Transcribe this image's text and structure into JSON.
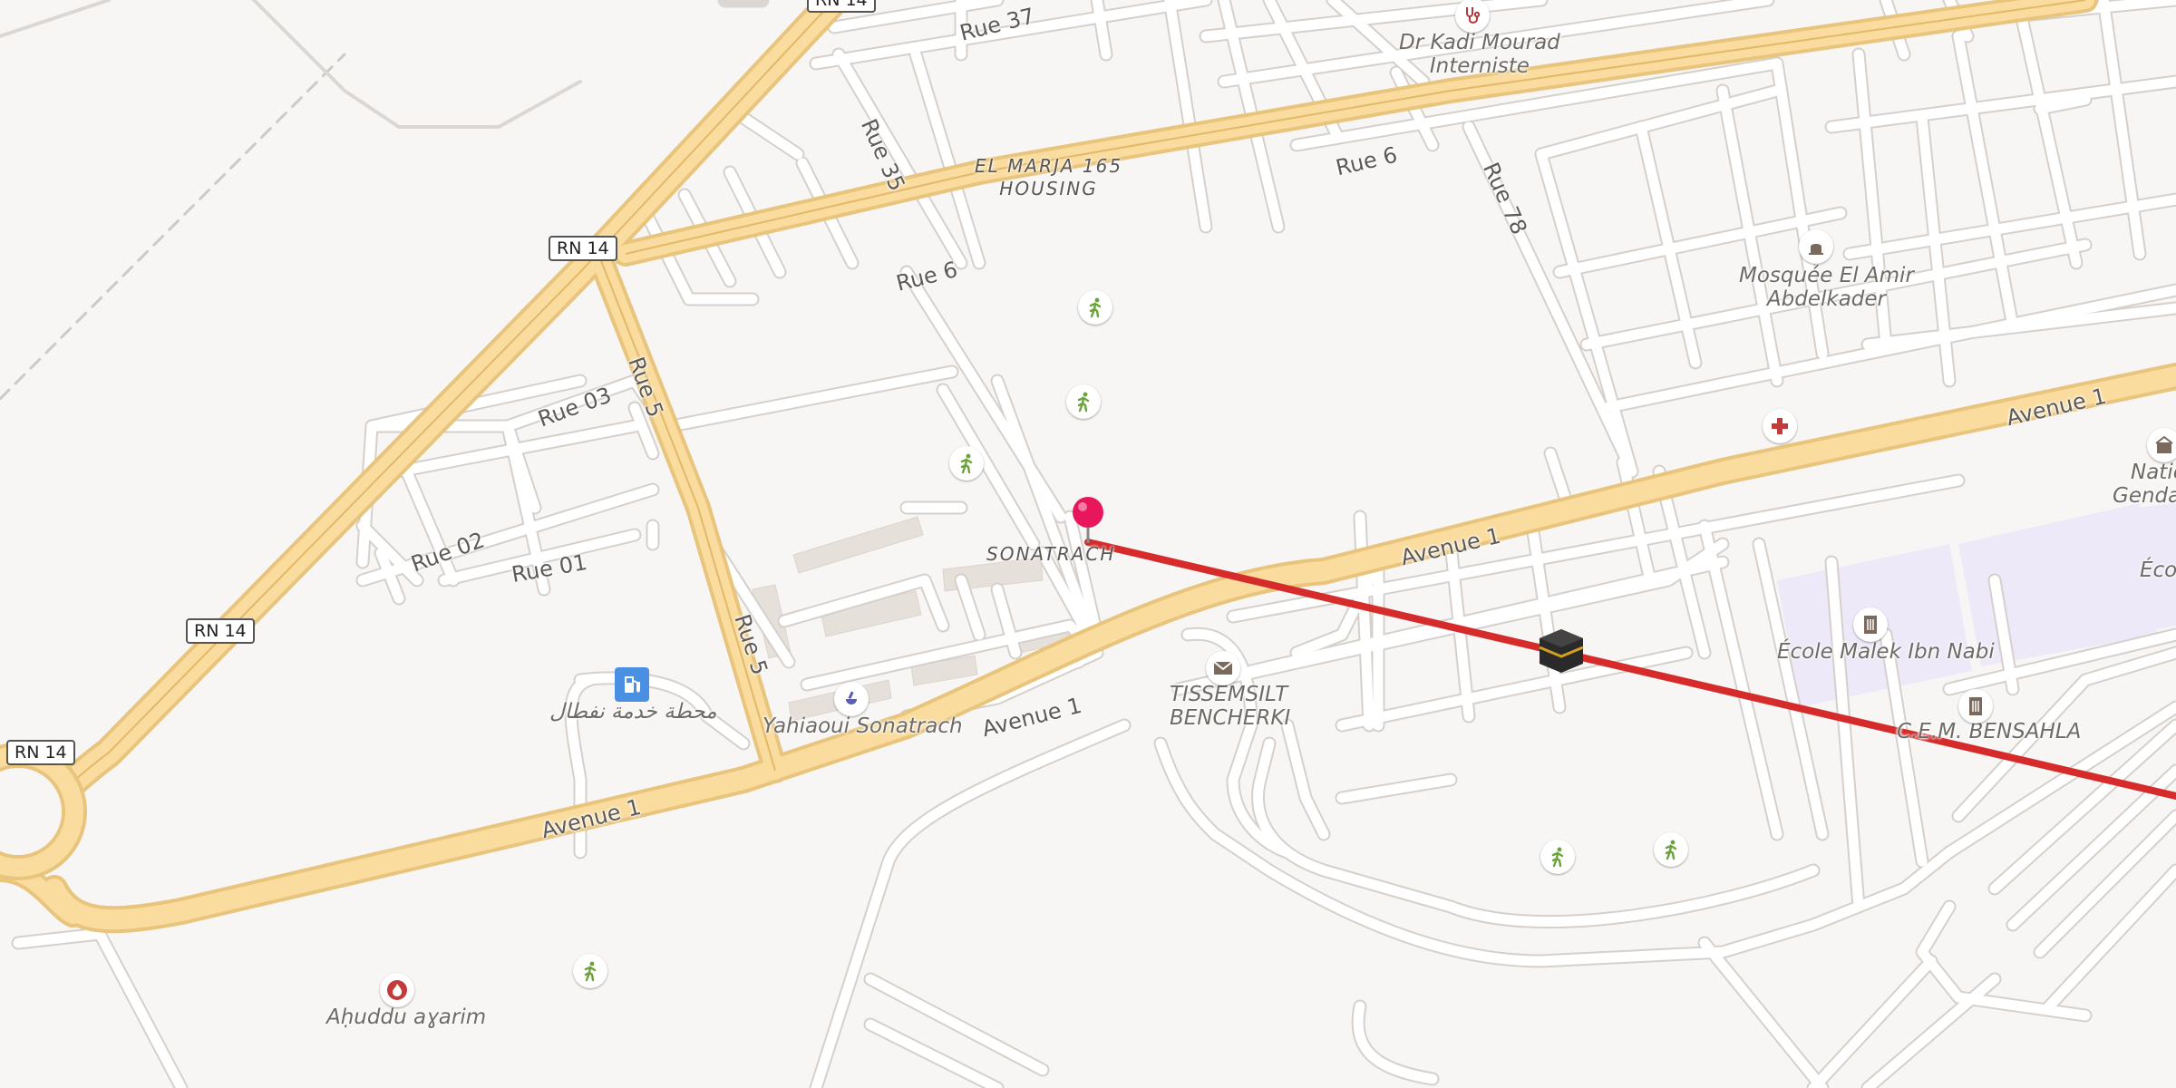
{
  "map": {
    "road_labels": {
      "rn14_top": "RN 14",
      "rn14_mid": "RN 14",
      "rn14_left": "RN 14",
      "rue37": "Rue 37",
      "rue35": "Rue 35",
      "rue6_a": "Rue 6",
      "rue6_b": "Rue 6",
      "rue78": "Rue 78",
      "rue03": "Rue 03",
      "rue02": "Rue 02",
      "rue01": "Rue 01",
      "rue5_a": "Rue 5",
      "rue5_b": "Rue 5",
      "avenue1_a": "Avenue 1",
      "avenue1_b": "Avenue 1",
      "avenue1_c": "Avenue 1",
      "avenue1_d": "Avenue 1"
    },
    "place_labels": {
      "dr_kadi_line1": "Dr Kadi Mourad",
      "dr_kadi_line2": "Interniste",
      "el_marja_line1": "EL MARJA 165",
      "el_marja_line2": "HOUSING",
      "mosque_line1": "Mosquée El Amir",
      "mosque_line2": "Abdelkader",
      "sonatrach": "SONATRACH",
      "tissemsilt_line1": "TISSEMSILT",
      "tissemsilt_line2": "BENCHERKI",
      "ecole_malek": "École Malek Ibn Nabi",
      "cem_bensahla": "C.E.M. BENSAHLA",
      "gas_station": "محطة خدمة نفطال",
      "pharmacy": "Yahiaoui Sonatrach",
      "fire": "Aḥuddu aɣarim",
      "nation_partial_1": "Natio",
      "nation_partial_2": "Gendar",
      "ecole_partial": "Écol"
    },
    "colors": {
      "background": "#f8f6f4",
      "major_road_fill": "#f9dc9e",
      "major_road_casing": "#e8c47c",
      "minor_road": "#ffffff",
      "minor_road_casing": "#dcd7d2",
      "route_line": "#d52b2b",
      "pin": "#e8175d",
      "school_area": "#ede9f8",
      "building": "#e6e0da"
    },
    "icons": [
      "recreation-icon",
      "doctor-icon",
      "place-of-worship-icon",
      "hospital-icon",
      "post-office-icon",
      "school-icon",
      "fuel-icon",
      "pharmacy-icon",
      "fire-station-icon",
      "destination-icon",
      "location-pin-icon"
    ]
  }
}
